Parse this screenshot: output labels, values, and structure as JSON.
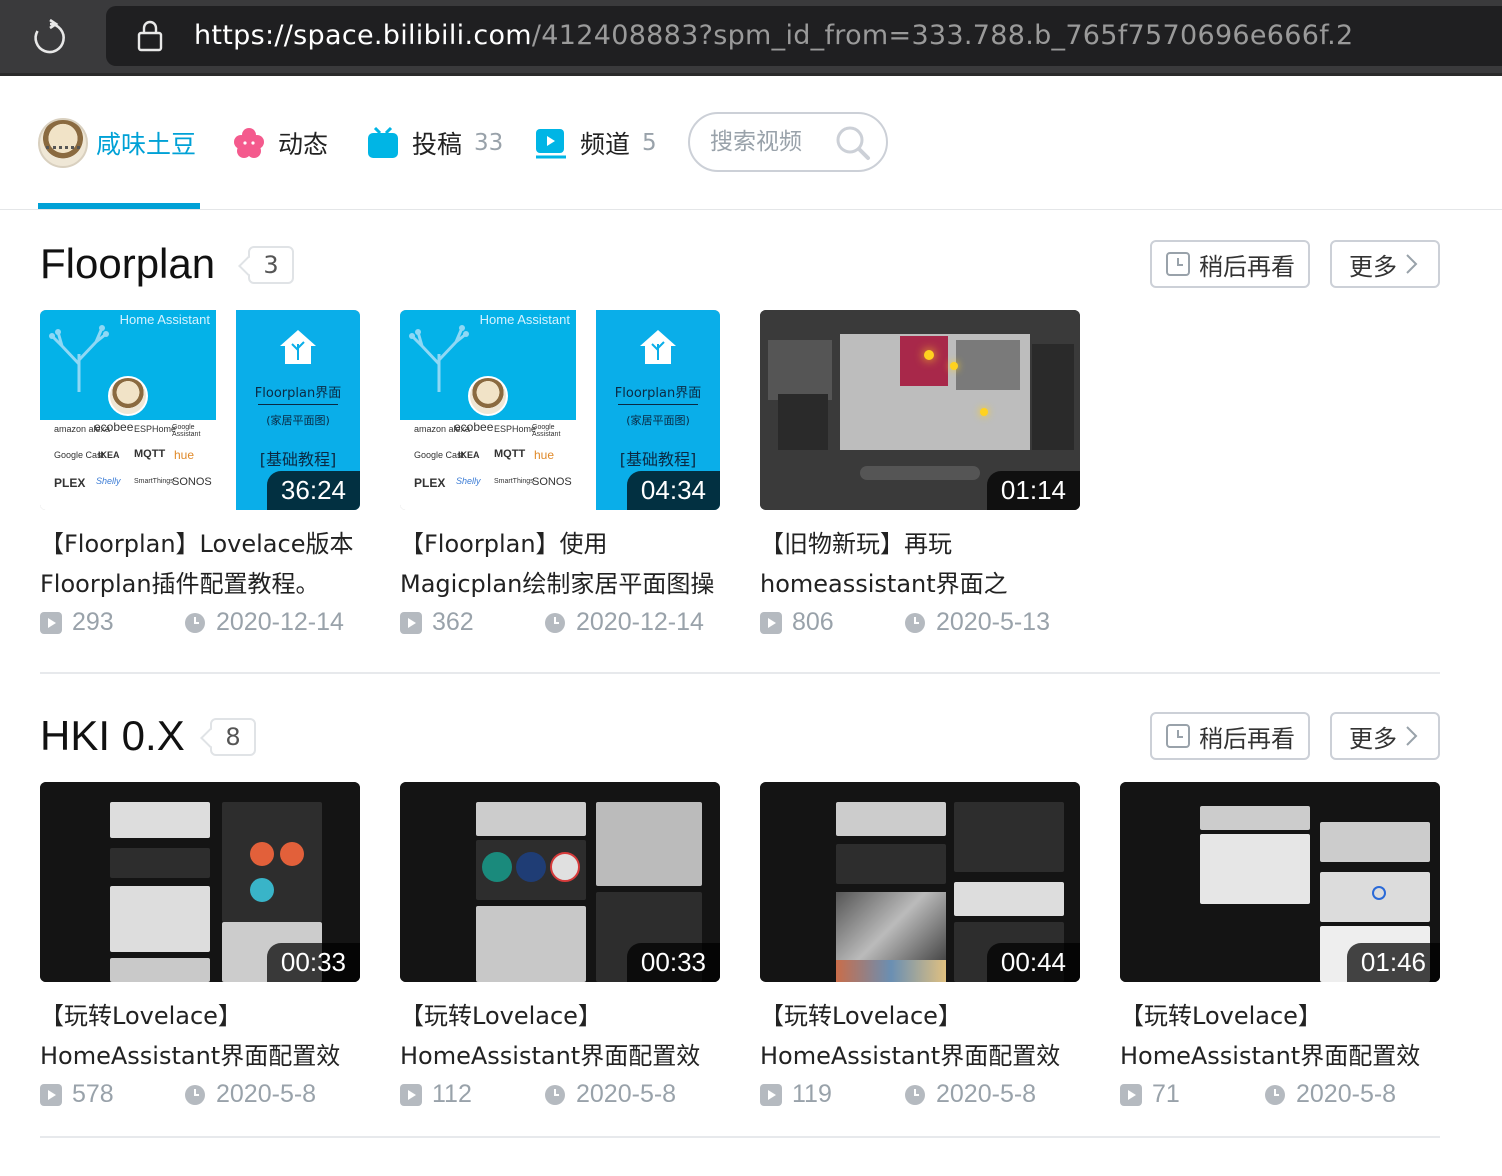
{
  "browser": {
    "url_host": "https://space.bilibili.com",
    "url_path": "/412408883?spm_id_from=333.788.b_765f7570696e666f.2"
  },
  "nav": {
    "home_label": "咸味土豆",
    "dynamic_label": "动态",
    "submit_label": "投稿",
    "submit_count": "33",
    "channel_label": "频道",
    "channel_count": "5",
    "search_placeholder": "搜索视频"
  },
  "colors": {
    "accent": "#00a1d6",
    "text_muted": "#99a2aa"
  },
  "sections": [
    {
      "title": "Floorplan",
      "count": "3",
      "watch_later": "稍后再看",
      "more": "更多",
      "videos": [
        {
          "title": "【Floorplan】Lovelace版本Floorplan插件配置教程。",
          "duration": "36:24",
          "views": "293",
          "date": "2020-12-14",
          "thumb": {
            "brand": "Home Assistant",
            "line1": "Floorplan界面",
            "line2": "(家居平面图)",
            "line3": "[基础教程]"
          }
        },
        {
          "title": "【Floorplan】使用Magicplan绘制家居平面图操",
          "duration": "04:34",
          "views": "362",
          "date": "2020-12-14",
          "thumb": {
            "brand": "Home Assistant",
            "line1": "Floorplan界面",
            "line2": "(家居平面图)",
            "line3": "[基础教程]"
          }
        },
        {
          "title": "【旧物新玩】再玩homeassistant界面之",
          "duration": "01:14",
          "views": "806",
          "date": "2020-5-13"
        }
      ]
    },
    {
      "title": "HKI 0.X",
      "count": "8",
      "watch_later": "稍后再看",
      "more": "更多",
      "videos": [
        {
          "title": "【玩转Lovelace】HomeAssistant界面配置效",
          "duration": "00:33",
          "views": "578",
          "date": "2020-5-8"
        },
        {
          "title": "【玩转Lovelace】HomeAssistant界面配置效",
          "duration": "00:33",
          "views": "112",
          "date": "2020-5-8"
        },
        {
          "title": "【玩转Lovelace】HomeAssistant界面配置效",
          "duration": "00:44",
          "views": "119",
          "date": "2020-5-8"
        },
        {
          "title": "【玩转Lovelace】HomeAssistant界面配置效",
          "duration": "01:46",
          "views": "71",
          "date": "2020-5-8"
        }
      ]
    }
  ]
}
